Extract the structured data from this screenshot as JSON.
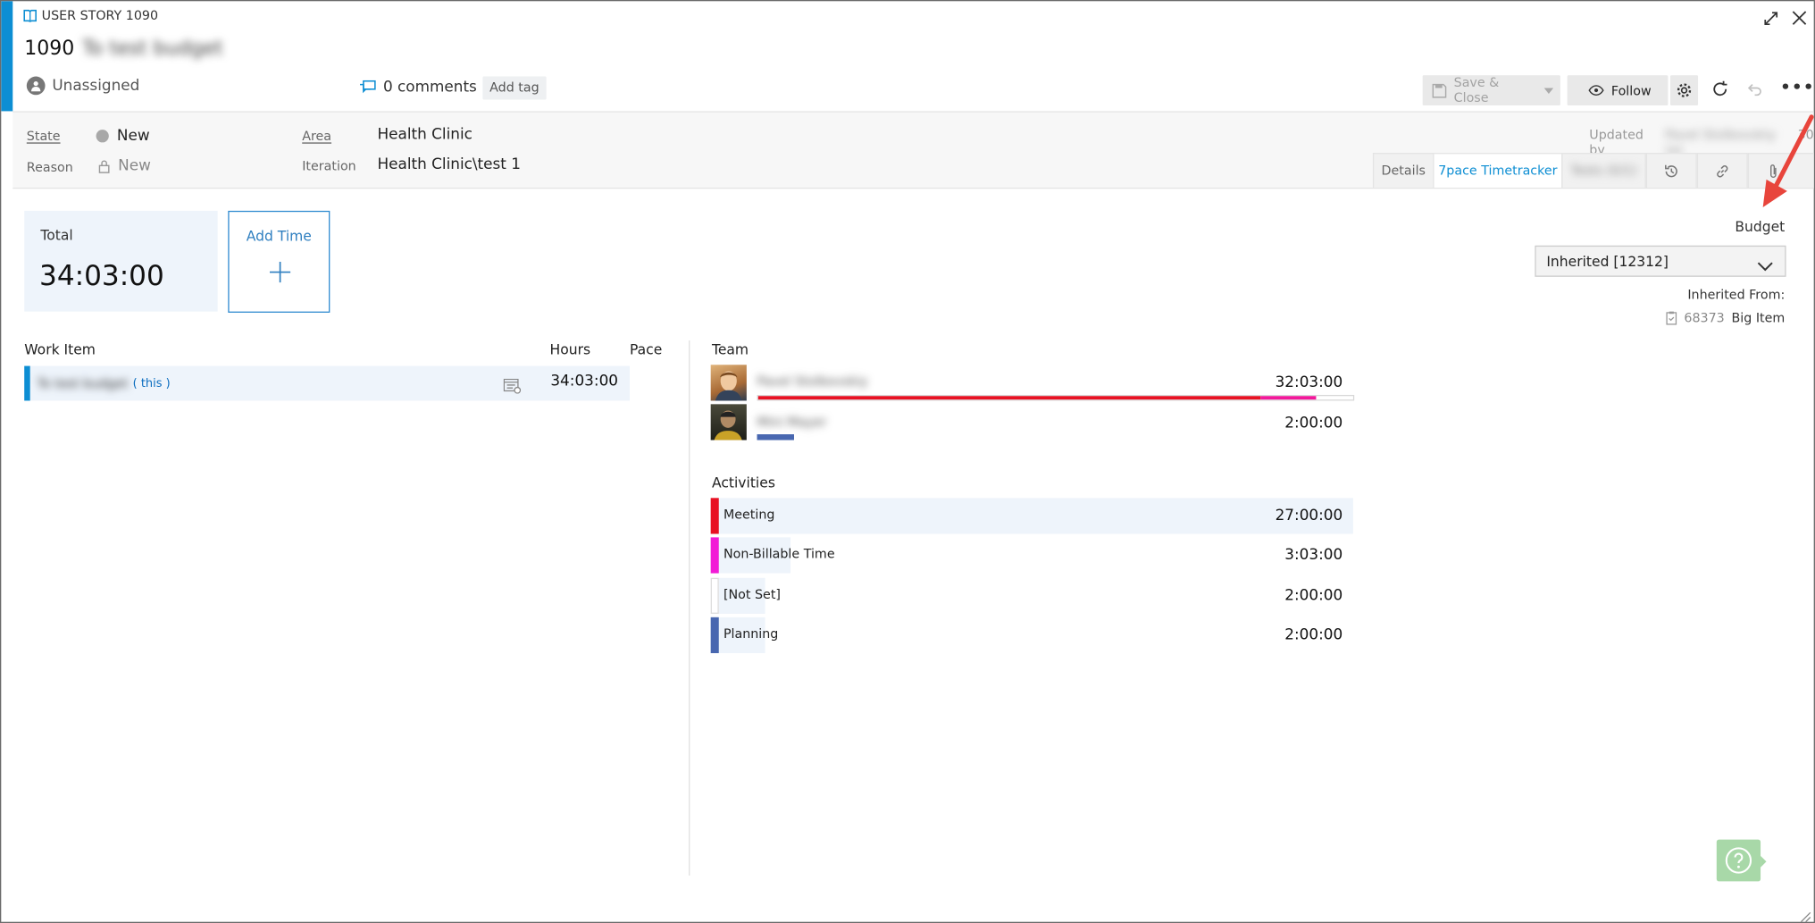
{
  "header": {
    "type_label": "USER STORY 1090",
    "id": "1090",
    "title": "To test budget",
    "assignee": "Unassigned",
    "comments": "0 comments",
    "add_tag": "Add tag",
    "save_close": "Save & Close",
    "follow": "Follow"
  },
  "fields": {
    "state_label": "State",
    "state_value": "New",
    "reason_label": "Reason",
    "reason_value": "New",
    "area_label": "Area",
    "area_value": "Health Clinic",
    "iteration_label": "Iteration",
    "iteration_value": "Health Clinic\\test 1",
    "updated_by_label": "Updated by",
    "updated_by_name": "Pavel Stolbovskiy (a)",
    "updated_by_suffix": "30"
  },
  "tabs": {
    "details": "Details",
    "timetracker": "7pace Timetracker",
    "blurred": "Tests (0/1)"
  },
  "summary": {
    "total_label": "Total",
    "total_value": "34:03:00",
    "add_time": "Add Time"
  },
  "budget": {
    "label": "Budget",
    "selected": "Inherited [12312]",
    "inherited_from_label": "Inherited From:",
    "inherited_id": "68373",
    "inherited_name": "Big Item"
  },
  "work_items": {
    "col_work_item": "Work Item",
    "col_hours": "Hours",
    "col_pace": "Pace",
    "rows": [
      {
        "name": "To test budget",
        "tag": "( this )",
        "hours": "34:03:00"
      }
    ]
  },
  "team": {
    "label": "Team",
    "members": [
      {
        "name": "Pavel Stolbovskiy",
        "hours": "32:03:00",
        "segments": [
          {
            "color": "#e81123",
            "fraction": 0.8434
          },
          {
            "color": "#f2199b",
            "fraction": 0.0945
          }
        ]
      },
      {
        "name": "Mini Mayer",
        "hours": "2:00:00",
        "segments": [
          {
            "color": "#4867b0",
            "fraction": 0.0621
          }
        ]
      }
    ]
  },
  "activities": {
    "label": "Activities",
    "rows": [
      {
        "name": "Meeting",
        "hours": "27:00:00",
        "color": "#e81123",
        "fraction": 1.0
      },
      {
        "name": "Non-Billable Time",
        "hours": "3:03:00",
        "color": "#f21bd6",
        "fraction": 0.125
      },
      {
        "name": "[Not Set]",
        "hours": "2:00:00",
        "color": "#ffffff",
        "fraction": 0.0839
      },
      {
        "name": "Planning",
        "hours": "2:00:00",
        "color": "#4867b0",
        "fraction": 0.0839
      }
    ]
  },
  "colors": {
    "accent": "#0d8ed3",
    "link": "#106ebe",
    "panel_bg": "#eef4fb",
    "arrow": "#e8453c",
    "help": "#a8d8a8"
  }
}
